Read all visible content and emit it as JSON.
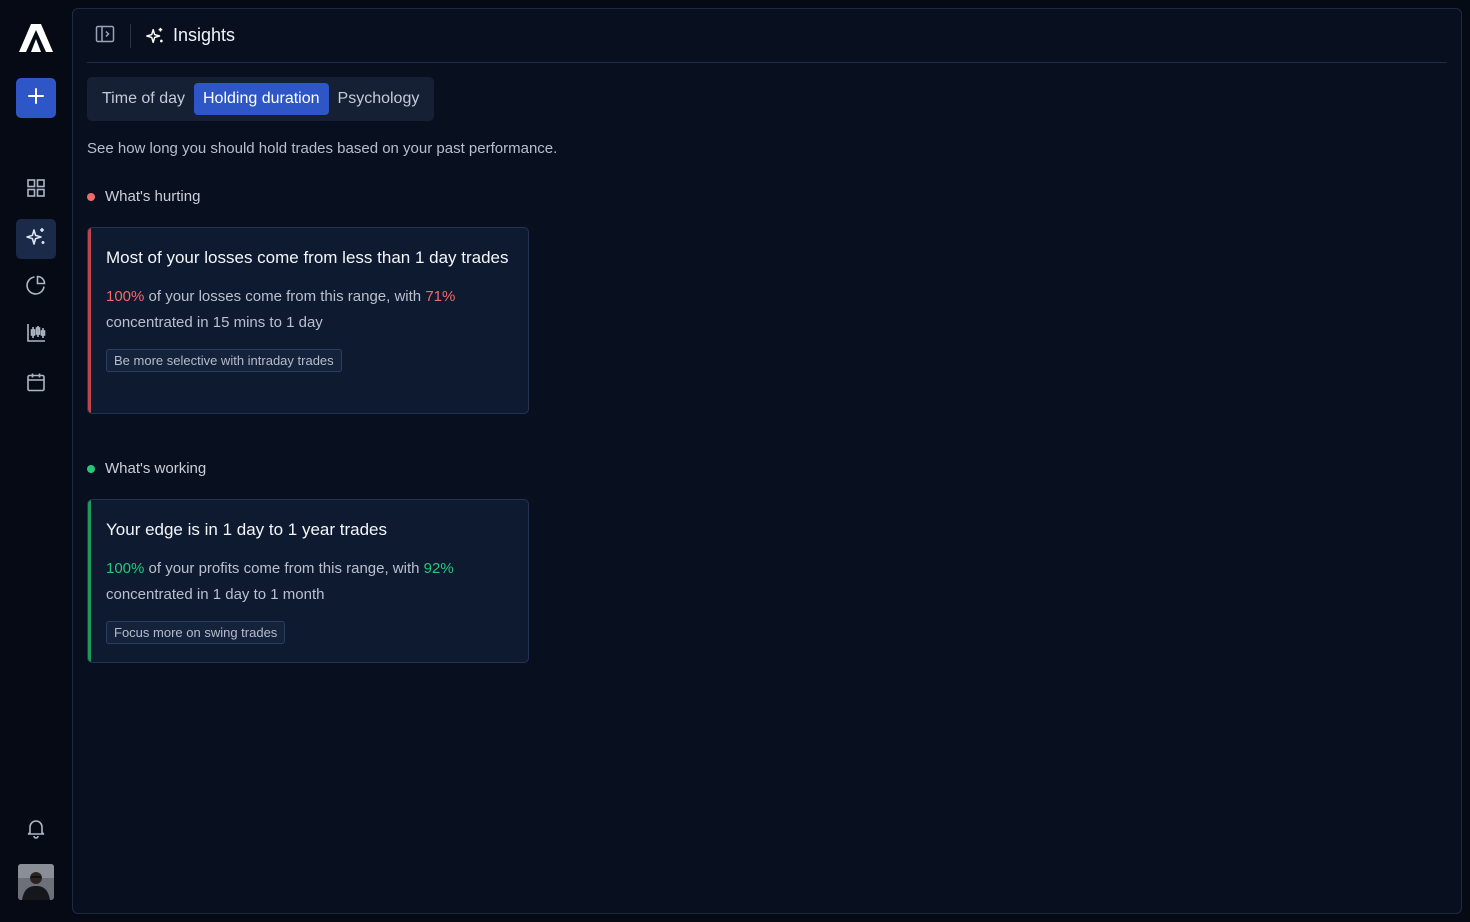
{
  "app": {
    "colors": {
      "accent": "#2f56c6",
      "loss": "#f06a6a",
      "profit": "#26c77a",
      "background": "#060a15"
    }
  },
  "sidebar": {
    "logo_icon": "brand-logo-icon",
    "new_button_icon": "plus-icon",
    "items": [
      {
        "icon": "dashboard-grid-icon",
        "active": false
      },
      {
        "icon": "sparkles-icon",
        "active": true
      },
      {
        "icon": "pie-chart-icon",
        "active": false
      },
      {
        "icon": "candlestick-chart-icon",
        "active": false
      },
      {
        "icon": "calendar-icon",
        "active": false
      }
    ],
    "notifications_icon": "bell-icon",
    "avatar_icon": "user-avatar"
  },
  "header": {
    "toggle_icon": "sidebar-toggle-icon",
    "title_icon": "sparkles-icon",
    "title": "Insights"
  },
  "tabs": [
    {
      "label": "Time of day",
      "active": false
    },
    {
      "label": "Holding duration",
      "active": true
    },
    {
      "label": "Psychology",
      "active": false
    }
  ],
  "subtitle": "See how long you should hold trades based on your past performance.",
  "hurting": {
    "label": "What's hurting",
    "card": {
      "title": "Most of your losses come from less than 1 day trades",
      "pct_main": "100%",
      "text_mid": " of your losses come from this range, with ",
      "pct_conc": "71%",
      "text_end": " concentrated in 15 mins to 1 day",
      "tip": "Be more selective with intraday trades"
    }
  },
  "working": {
    "label": "What's working",
    "card": {
      "title": "Your edge is in 1 day to 1 year trades",
      "pct_main": "100%",
      "text_mid": " of your profits come from this range, with ",
      "pct_conc": "92%",
      "text_end": " concentrated in 1 day to 1 month",
      "tip": "Focus more on swing trades"
    }
  }
}
